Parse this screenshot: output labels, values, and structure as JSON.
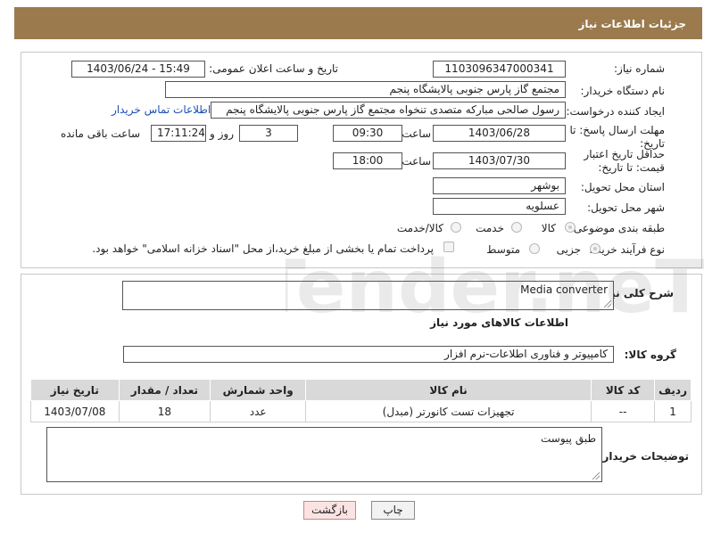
{
  "header": {
    "title": "جزئیات اطلاعات نیاز"
  },
  "form": {
    "need_number_label": "شماره نیاز:",
    "need_number": "1103096347000341",
    "announce_label": "تاریخ و ساعت اعلان عمومی:",
    "announce_value": "1403/06/24 - 15:49",
    "buyer_org_label": "نام دستگاه خریدار:",
    "buyer_org": "مجتمع گاز پارس جنوبی  پالایشگاه پنجم",
    "creator_label": "ایجاد کننده درخواست:",
    "creator": "رسول صالحی مبارکه متصدی تنخواه مجتمع گاز پارس جنوبی  پالایشگاه پنجم",
    "contact_link": "اطلاعات تماس خریدار",
    "reply_deadline_label": "مهلت ارسال پاسخ: تا تاریخ:",
    "reply_date": "1403/06/28",
    "time_label": "ساعت",
    "reply_time": "09:30",
    "days_count": "3",
    "days_label": "روز و",
    "remaining_time": "17:11:24",
    "remaining_label": "ساعت باقی مانده",
    "price_validity_label": "حداقل تاریخ اعتبار قیمت: تا تاریخ:",
    "price_date": "1403/07/30",
    "price_time": "18:00",
    "province_label": "استان محل تحویل:",
    "province": "بوشهر",
    "city_label": "شهر محل تحویل:",
    "city": "عسلویه",
    "category_label": "طبقه بندی موضوعی:",
    "category_options": [
      "کالا",
      "خدمت",
      "کالا/خدمت"
    ],
    "purchase_type_label": "نوع فرآیند خرید :",
    "purchase_options": [
      "جزیی",
      "متوسط"
    ],
    "payment_note": "پرداخت تمام یا بخشی از مبلغ خرید،از محل \"اسناد خزانه اسلامی\" خواهد بود."
  },
  "details": {
    "general_desc_label": "شرح کلی نیاز:",
    "general_desc": "Media converter",
    "goods_info_title": "اطلاعات کالاهای مورد نیاز",
    "goods_group_label": "گروه کالا:",
    "goods_group": "کامپیوتر و فناوری اطلاعات-نرم افزار",
    "table_headers": [
      "ردیف",
      "کد کالا",
      "نام کالا",
      "واحد شمارش",
      "تعداد / مقدار",
      "تاریخ نیاز"
    ],
    "table_rows": [
      [
        "1",
        "--",
        "تجهیزات تست کانورتر (مبدل)",
        "عدد",
        "18",
        "1403/07/08"
      ]
    ],
    "buyer_notes_label": "توضیحات خریدار:",
    "buyer_notes": "طبق پیوست"
  },
  "buttons": {
    "print": "چاپ",
    "back": "بازگشت"
  },
  "watermark": {
    "text": "AriaTender.neT"
  }
}
